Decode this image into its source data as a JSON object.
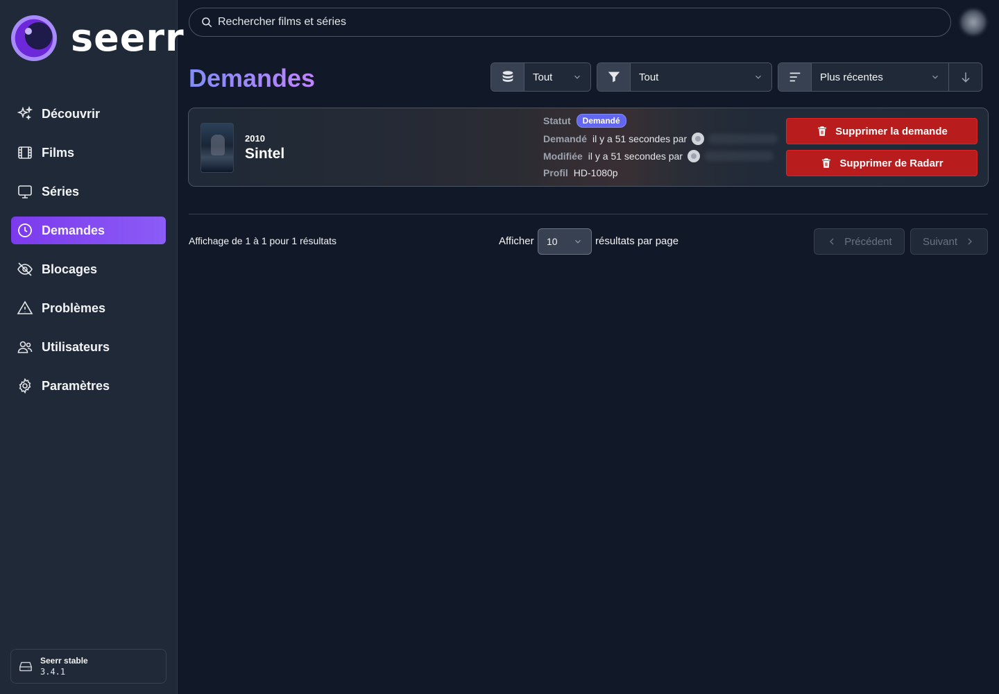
{
  "app": {
    "name": "seerr"
  },
  "sidebar": {
    "items": [
      {
        "label": "Découvrir",
        "icon": "sparkles-icon"
      },
      {
        "label": "Films",
        "icon": "film-icon"
      },
      {
        "label": "Séries",
        "icon": "tv-icon"
      },
      {
        "label": "Demandes",
        "icon": "clock-icon",
        "active": true
      },
      {
        "label": "Blocages",
        "icon": "eye-off-icon"
      },
      {
        "label": "Problèmes",
        "icon": "warning-icon"
      },
      {
        "label": "Utilisateurs",
        "icon": "users-icon"
      },
      {
        "label": "Paramètres",
        "icon": "cog-icon"
      }
    ],
    "version": {
      "name": "Seerr stable",
      "number": "3.4.1"
    }
  },
  "search": {
    "placeholder": "Rechercher films et séries"
  },
  "page": {
    "title": "Demandes"
  },
  "filters": {
    "media": {
      "value": "Tout",
      "icon": "database-icon"
    },
    "status": {
      "value": "Tout",
      "icon": "filter-icon"
    },
    "sort": {
      "value": "Plus récentes",
      "icon": "sort-lines-icon",
      "direction_icon": "arrow-down-icon"
    }
  },
  "requests": [
    {
      "year": "2010",
      "title": "Sintel",
      "status_label": "Statut",
      "status": "Demandé",
      "requested_label": "Demandé",
      "requested_text": "il y a 51 secondes par",
      "modified_label": "Modifiée",
      "modified_text": "il y a 51 secondes par",
      "profile_label": "Profil",
      "profile": "HD-1080p",
      "actions": [
        "Supprimer la demande",
        "Supprimer de Radarr"
      ]
    }
  ],
  "pagination": {
    "info": "Affichage de 1 à 1 pour 1 résultats",
    "show_label": "Afficher",
    "per_page": "10",
    "per_page_suffix": "résultats par page",
    "previous": "Précédent",
    "next": "Suivant"
  },
  "colors": {
    "accent": "#7c3aed",
    "danger": "#b91c1c",
    "badge": "#6366f1",
    "background": "#111827"
  }
}
